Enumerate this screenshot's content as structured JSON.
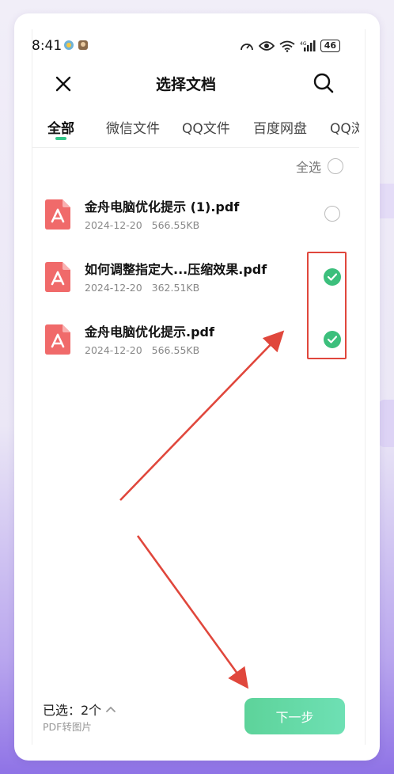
{
  "status_bar": {
    "time": "8:41",
    "battery": "46"
  },
  "header": {
    "title": "选择文档"
  },
  "tabs": [
    {
      "label": "全部"
    },
    {
      "label": "微信文件"
    },
    {
      "label": "QQ文件"
    },
    {
      "label": "百度网盘"
    },
    {
      "label": "QQ浏"
    }
  ],
  "select_all_label": "全选",
  "files": [
    {
      "name": "金舟电脑优化提示 (1).pdf",
      "date": "2024-12-20",
      "size": "566.55KB",
      "selected": false
    },
    {
      "name": "如何调整指定大...压缩效果.pdf",
      "date": "2024-12-20",
      "size": "362.51KB",
      "selected": true
    },
    {
      "name": "金舟电脑优化提示.pdf",
      "date": "2024-12-20",
      "size": "566.55KB",
      "selected": true
    }
  ],
  "bottom": {
    "selected_text": "已选：2个",
    "sub_label": "PDF转图片",
    "next_label": "下一步"
  },
  "colors": {
    "accent": "#3cbf7c",
    "annotation": "#e0473c",
    "pdf_icon": "#f06a6a"
  }
}
